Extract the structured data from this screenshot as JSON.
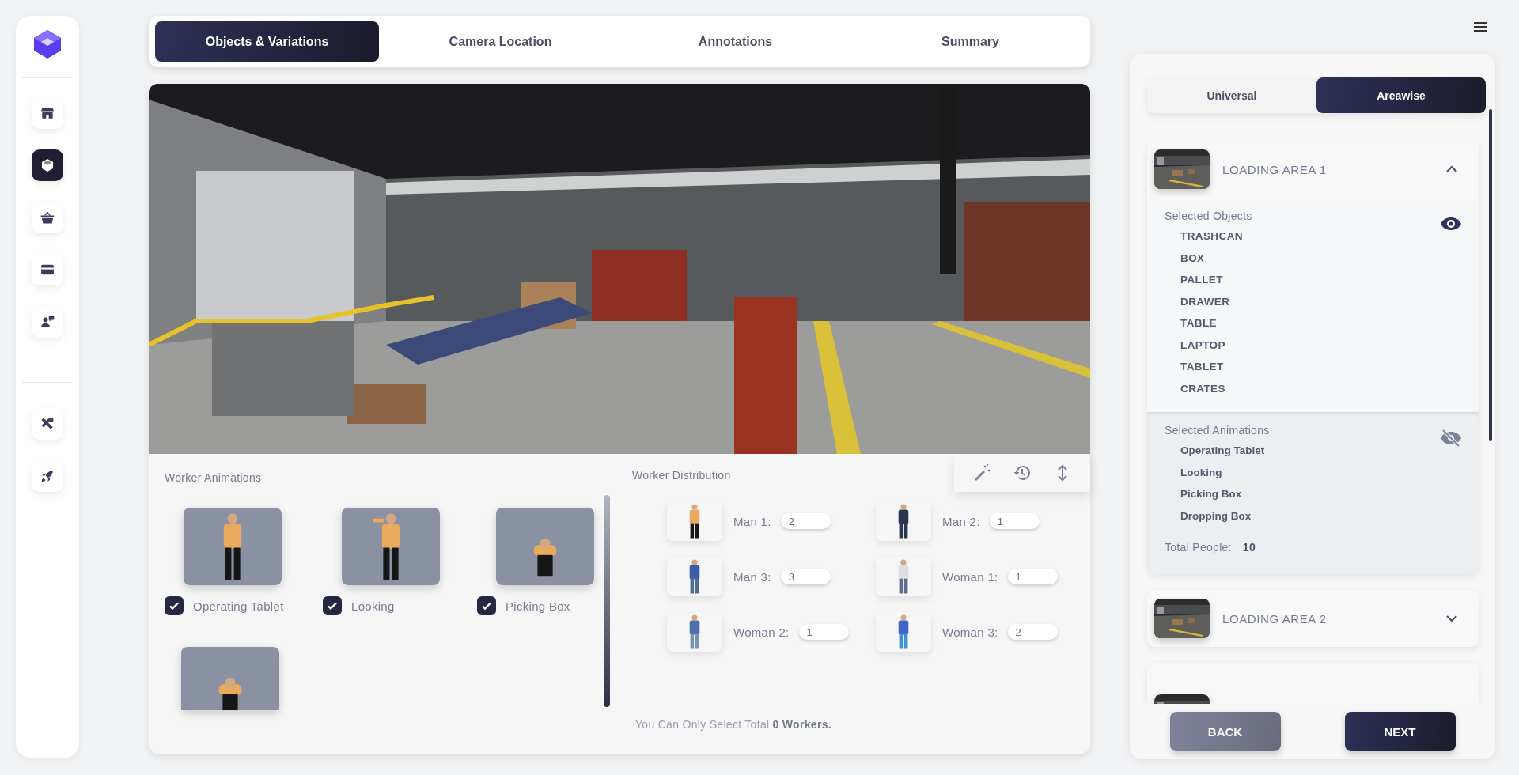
{
  "sidebar": {
    "items": [
      {
        "selected": false
      },
      {
        "selected": true
      },
      {
        "selected": false
      },
      {
        "selected": false
      },
      {
        "selected": false
      },
      {
        "selected": false
      },
      {
        "selected": false
      }
    ]
  },
  "tabs": [
    {
      "label": "Objects & Variations",
      "selected": true
    },
    {
      "label": "Camera Location",
      "selected": false
    },
    {
      "label": "Annotations",
      "selected": false
    },
    {
      "label": "Summary",
      "selected": false
    }
  ],
  "worker_animations": {
    "title": "Worker Animations",
    "items": [
      {
        "kind": "labeled",
        "label": "Operating Tablet",
        "checked": true
      },
      {
        "kind": "labeled",
        "label": "Looking",
        "checked": true
      },
      {
        "kind": "labeled",
        "label": "Picking Box",
        "checked": true
      },
      {
        "kind": "cut"
      }
    ]
  },
  "worker_distribution": {
    "title": "Worker Distribution",
    "workers": [
      {
        "label": "Man 1:",
        "value": "2"
      },
      {
        "label": "Man 2:",
        "value": "1"
      },
      {
        "label": "Man 3:",
        "value": "3"
      },
      {
        "label": "Woman 1:",
        "value": "1"
      },
      {
        "label": "Woman 2:",
        "value": "1"
      },
      {
        "label": "Woman 3:",
        "value": "2"
      }
    ],
    "note": "You Can Only Select Total **0 Workers.**"
  },
  "mode_toggle": [
    {
      "label": "Universal",
      "selected": false
    },
    {
      "label": "Areawise",
      "selected": true
    }
  ],
  "areas": [
    {
      "title": "LOADING AREA 1",
      "expanded": true,
      "partial": false,
      "sections": [
        {
          "kind": "objects",
          "title": "Selected Objects",
          "visible": true,
          "items": [
            "TRASHCAN",
            "BOX",
            "PALLET",
            "DRAWER",
            "TABLE",
            "LAPTOP",
            "TABLET",
            "CRATES"
          ]
        },
        {
          "kind": "animations",
          "title": "Selected Animations",
          "visible": false,
          "items": [
            "Operating Tablet",
            "Looking",
            "Picking Box",
            "Dropping Box"
          ],
          "total_label": "Total People:",
          "total_value": "10"
        }
      ]
    },
    {
      "title": "LOADING AREA 2",
      "expanded": false,
      "partial": false
    },
    {
      "partial": true
    }
  ],
  "buttons": [
    {
      "label": "BACK",
      "kind": "secondary"
    },
    {
      "label": "NEXT",
      "kind": "primary"
    }
  ]
}
